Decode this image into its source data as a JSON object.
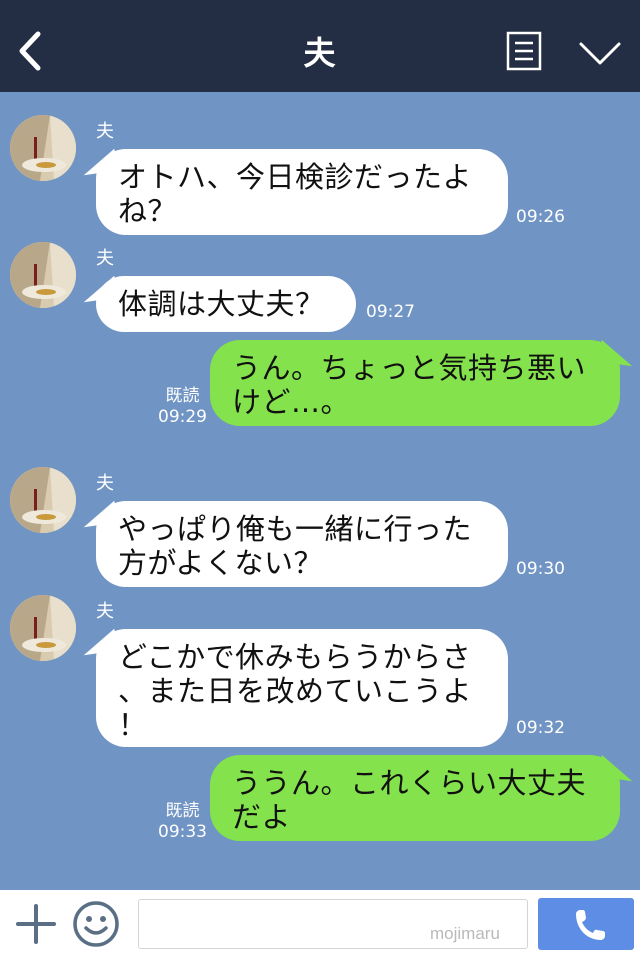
{
  "header": {
    "title": "夫",
    "back_icon": "chevron-left-icon",
    "menu_icon": "list-icon",
    "dropdown_icon": "chevron-down-icon"
  },
  "messages": [
    {
      "sender": "夫",
      "direction": "in",
      "lines": [
        "オトハ、今日検診だったよ",
        "ね？"
      ],
      "time": "09:26"
    },
    {
      "sender": "夫",
      "direction": "in",
      "lines": [
        "体調は大丈夫？"
      ],
      "time": "09:27"
    },
    {
      "direction": "out",
      "lines": [
        "うん。ちょっと気持ち悪い",
        "けど…。"
      ],
      "read": "既読",
      "time": "09:29"
    },
    {
      "sender": "夫",
      "direction": "in",
      "lines": [
        "やっぱり俺も一緒に行った",
        "方がよくない？"
      ],
      "time": "09:30"
    },
    {
      "sender": "夫",
      "direction": "in",
      "lines": [
        "どこかで休みもらうからさ",
        "、また日を改めていこうよ",
        "！"
      ],
      "time": "09:32"
    },
    {
      "direction": "out",
      "lines": [
        "ううん。これくらい大丈夫",
        "だよ"
      ],
      "read": "既読",
      "time": "09:33"
    }
  ],
  "footer": {
    "plus_icon": "plus-icon",
    "sticker_icon": "smiley-icon",
    "input_placeholder": "",
    "watermark": "mojimaru",
    "call_icon": "phone-icon"
  },
  "colors": {
    "header_bg": "#232d43",
    "chat_bg": "#7094c4",
    "incoming_bubble": "#ffffff",
    "outgoing_bubble": "#84e24c",
    "call_button": "#5d8de5"
  }
}
